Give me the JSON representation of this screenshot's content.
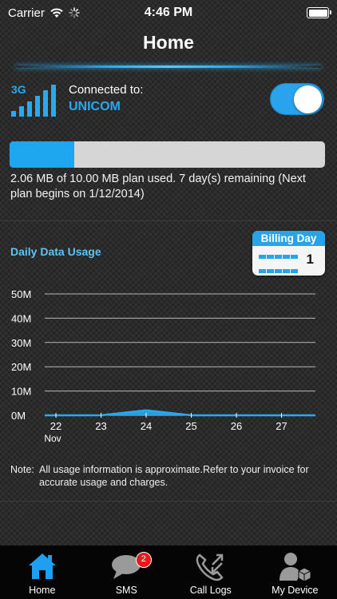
{
  "status_bar": {
    "carrier": "Carrier",
    "time": "4:46 PM"
  },
  "nav": {
    "title": "Home"
  },
  "connection": {
    "network_type": "3G",
    "label": "Connected to:",
    "carrier_name": "UNICOM",
    "enabled": true
  },
  "usage": {
    "used_fraction": 0.206,
    "summary": "2.06 MB of 10.00 MB plan used. 7 day(s) remaining (Next plan begins on 1/12/2014)"
  },
  "daily_usage": {
    "title": "Daily Data Usage",
    "billing_day_label": "Billing Day",
    "billing_day_value": "1"
  },
  "chart_data": {
    "type": "area",
    "x": [
      "22",
      "23",
      "24",
      "25",
      "26",
      "27"
    ],
    "x_sublabel": "Nov",
    "y_ticks": [
      "0M",
      "10M",
      "20M",
      "30M",
      "40M",
      "50M"
    ],
    "ylim": [
      0,
      50
    ],
    "series": [
      {
        "values": [
          0,
          0,
          2.06,
          0,
          0,
          0
        ]
      }
    ],
    "colors": {
      "line": "#2aa9f0",
      "grid": "#d0d0d0"
    },
    "grid": true
  },
  "note": {
    "label": "Note:",
    "text": "All usage information is approximate.Refer to your invoice for accurate usage and charges."
  },
  "tabs": [
    {
      "label": "Home",
      "icon": "home-icon",
      "active": true
    },
    {
      "label": "SMS",
      "icon": "sms-icon",
      "badge": "2"
    },
    {
      "label": "Call Logs",
      "icon": "call-logs-icon"
    },
    {
      "label": "My Device",
      "icon": "my-device-icon"
    }
  ],
  "colors": {
    "accent": "#29aaf0",
    "badge": "#e8191d"
  }
}
